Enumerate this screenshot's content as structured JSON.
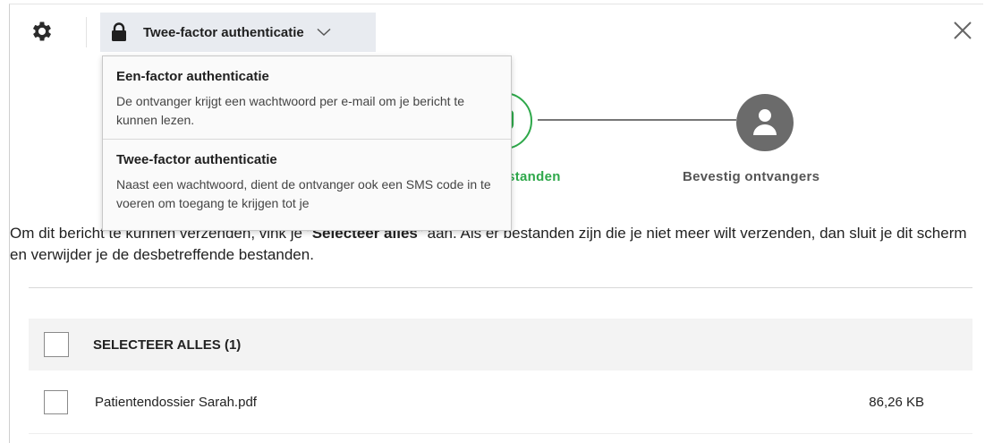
{
  "header": {
    "auth_method_selected": "Twee-factor authenticatie",
    "icons": [
      "gear-icon",
      "lock-icon",
      "chevron-down-icon",
      "close-icon"
    ]
  },
  "dropdown": {
    "options": [
      {
        "title": "Een-factor authenticatie",
        "description": "De ontvanger krijgt een wachtwoord per e-mail om je bericht te kunnen lezen."
      },
      {
        "title": "Twee-factor authenticatie",
        "description": "Naast een wachtwoord, dient de ontvanger ook een SMS code in te voeren om toegang te krijgen tot je"
      }
    ]
  },
  "steps": [
    {
      "label": "bestanden",
      "state": "active",
      "icon": "paperclip-icon",
      "color": "#2ea84a"
    },
    {
      "label": "Bevestig ontvangers",
      "state": "pending",
      "icon": "user-icon",
      "color": "#6b6b6b"
    }
  ],
  "instruction": {
    "before": "Om dit bericht te kunnen verzenden, vink je \"",
    "bold": "Selecteer alles",
    "after": "\" aan. Als er bestanden zijn die je niet meer wilt verzenden, dan sluit je dit scherm en verwijder je de desbetreffende bestanden."
  },
  "table": {
    "select_all_label": "SELECTEER ALLES (1)",
    "files": [
      {
        "name": "Patientendossier Sarah.pdf",
        "size": "86,26 KB",
        "checked": false
      }
    ]
  },
  "colors": {
    "accent": "#2ea84a",
    "select_bg": "#e8ebf0",
    "row_bg": "#f3f3f3"
  }
}
